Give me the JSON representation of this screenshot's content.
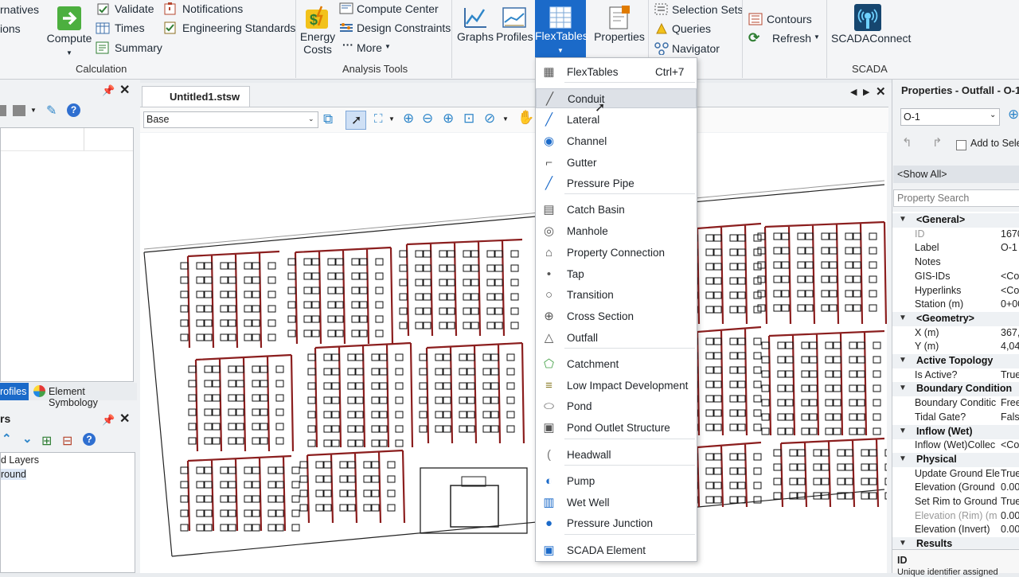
{
  "ribbon": {
    "cut_left_1": "rnatives",
    "cut_left_2": "ions",
    "compute": "Compute",
    "validate": "Validate",
    "times": "Times",
    "summary": "Summary",
    "notifications": "Notifications",
    "eng_standards": "Engineering Standards",
    "group_calc": "Calculation",
    "energy_costs_1": "Energy",
    "energy_costs_2": "Costs",
    "compute_center": "Compute Center",
    "design_constraints": "Design Constraints",
    "more": "More",
    "group_analysis": "Analysis Tools",
    "graphs": "Graphs",
    "profiles": "Profiles",
    "flextables": "FlexTables",
    "properties": "Properties",
    "selection_sets": "Selection Sets",
    "queries": "Queries",
    "navigator": "Navigator",
    "contours": "Contours",
    "refresh": "Refresh",
    "scadaconnect": "SCADAConnect",
    "group_scada": "SCADA"
  },
  "left": {
    "tab_profiles": "rofiles",
    "tab_symbology": "Element Symbology",
    "layers_title": "rs",
    "layer1": "d Layers",
    "layer2": "round"
  },
  "doc": {
    "tab": "Untitled1.stsw",
    "scenario": "Base"
  },
  "menu": {
    "items": [
      {
        "label": "FlexTables",
        "shortcut": "Ctrl+7",
        "icon": "flextables-icon"
      },
      {
        "label": "Conduit",
        "icon": "conduit-icon"
      },
      {
        "label": "Lateral",
        "icon": "lateral-icon"
      },
      {
        "label": "Channel",
        "icon": "channel-icon"
      },
      {
        "label": "Gutter",
        "icon": "gutter-icon"
      },
      {
        "label": "Pressure Pipe",
        "icon": "pressure-pipe-icon"
      },
      {
        "label": "Catch Basin",
        "icon": "catch-basin-icon"
      },
      {
        "label": "Manhole",
        "icon": "manhole-icon"
      },
      {
        "label": "Property Connection",
        "icon": "property-connection-icon"
      },
      {
        "label": "Tap",
        "icon": "tap-icon"
      },
      {
        "label": "Transition",
        "icon": "transition-icon"
      },
      {
        "label": "Cross Section",
        "icon": "cross-section-icon"
      },
      {
        "label": "Outfall",
        "icon": "outfall-icon"
      },
      {
        "label": "Catchment",
        "icon": "catchment-icon"
      },
      {
        "label": "Low Impact Development",
        "icon": "lid-icon"
      },
      {
        "label": "Pond",
        "icon": "pond-icon"
      },
      {
        "label": "Pond Outlet Structure",
        "icon": "pond-outlet-icon"
      },
      {
        "label": "Headwall",
        "icon": "headwall-icon"
      },
      {
        "label": "Pump",
        "icon": "pump-icon"
      },
      {
        "label": "Wet Well",
        "icon": "wet-well-icon"
      },
      {
        "label": "Pressure Junction",
        "icon": "pressure-junction-icon"
      },
      {
        "label": "SCADA Element",
        "icon": "scada-element-icon"
      }
    ]
  },
  "props": {
    "title": "Properties - Outfall - O-1",
    "selector": "O-1",
    "add_to_sel": "Add to Sele",
    "show_all": "<Show All>",
    "search_placeholder": "Property Search",
    "rows": [
      {
        "k": "<General>",
        "v": "",
        "cat": true
      },
      {
        "k": "ID",
        "v": "1670",
        "dim": true
      },
      {
        "k": "Label",
        "v": "O-1"
      },
      {
        "k": "Notes",
        "v": ""
      },
      {
        "k": "GIS-IDs",
        "v": "<Col"
      },
      {
        "k": "Hyperlinks",
        "v": "<Col"
      },
      {
        "k": "Station (m)",
        "v": "0+00"
      },
      {
        "k": "<Geometry>",
        "v": "",
        "cat": true
      },
      {
        "k": "X (m)",
        "v": "367,"
      },
      {
        "k": "Y (m)",
        "v": "4,04"
      },
      {
        "k": "Active Topology",
        "v": "",
        "cat": true
      },
      {
        "k": "Is Active?",
        "v": "True"
      },
      {
        "k": "Boundary Condition",
        "v": "",
        "cat": true
      },
      {
        "k": "Boundary Conditic",
        "v": "Free"
      },
      {
        "k": "Tidal Gate?",
        "v": "False"
      },
      {
        "k": "Inflow (Wet)",
        "v": "",
        "cat": true
      },
      {
        "k": "Inflow (Wet)Collec",
        "v": "<Col"
      },
      {
        "k": "Physical",
        "v": "",
        "cat": true
      },
      {
        "k": "Update Ground Ele",
        "v": "True"
      },
      {
        "k": "Elevation (Ground",
        "v": "0.00"
      },
      {
        "k": "Set Rim to Ground",
        "v": "True"
      },
      {
        "k": "Elevation (Rim) (m",
        "v": "0.00",
        "dim": true
      },
      {
        "k": "Elevation (Invert)",
        "v": "0.00"
      },
      {
        "k": "Results",
        "v": "",
        "cat": true
      }
    ],
    "footer_title": "ID",
    "footer_desc": "Unique identifier assigned"
  }
}
